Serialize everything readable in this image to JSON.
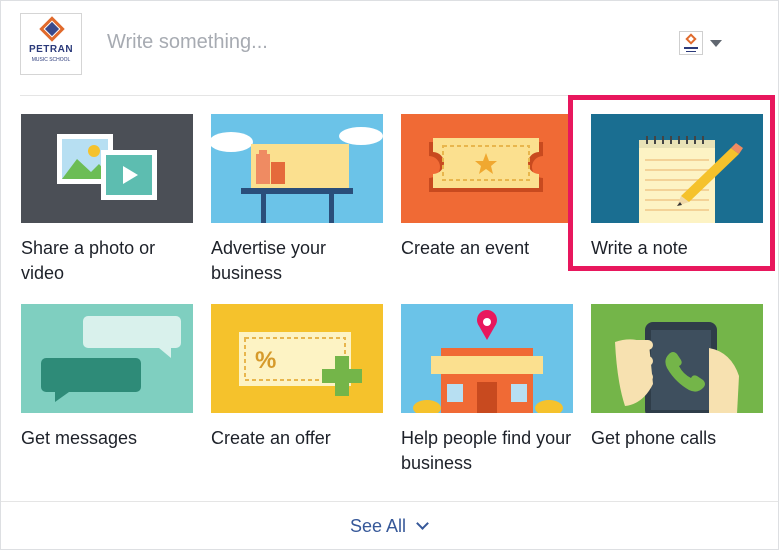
{
  "page": {
    "logo_name": "PETRAN",
    "logo_subtitle": "MUSIC SCHOOL"
  },
  "composer": {
    "placeholder": "Write something..."
  },
  "actions": [
    {
      "label": "Share a photo or video",
      "icon": "photo-video-icon",
      "bg": "#4b4f56"
    },
    {
      "label": "Advertise your business",
      "icon": "billboard-icon",
      "bg": "#6bc3e8"
    },
    {
      "label": "Create an event",
      "icon": "ticket-icon",
      "bg": "#f06a35"
    },
    {
      "label": "Write a note",
      "icon": "notepad-pencil-icon",
      "bg": "#1a6e91"
    },
    {
      "label": "Get messages",
      "icon": "chat-bubbles-icon",
      "bg": "#7fcfc0"
    },
    {
      "label": "Create an offer",
      "icon": "coupon-icon",
      "bg": "#f5c22c"
    },
    {
      "label": "Help people find your business",
      "icon": "storefront-pin-icon",
      "bg": "#6bc3e8"
    },
    {
      "label": "Get phone calls",
      "icon": "phone-call-icon",
      "bg": "#74b549"
    }
  ],
  "highlight_color": "#e8175d",
  "footer": {
    "see_all": "See All"
  }
}
